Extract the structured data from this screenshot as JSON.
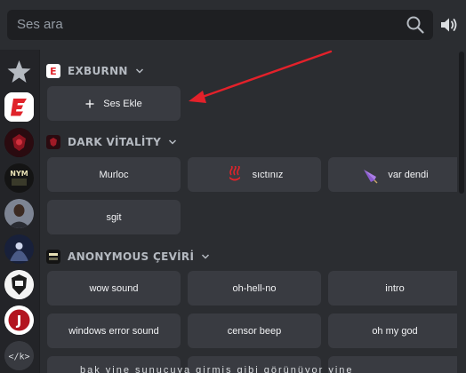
{
  "search": {
    "placeholder": "Ses ara",
    "icon": "search-icon"
  },
  "volume": {
    "icon": "volume-icon"
  },
  "rail": {
    "items": [
      {
        "name": "favorites",
        "icon": "star-icon"
      },
      {
        "name": "exburnn",
        "icon": "exburnn-logo-icon",
        "label": "E"
      },
      {
        "name": "dark-vitality",
        "icon": "dark-vitality-icon"
      },
      {
        "name": "anonymous-ceviri",
        "icon": "anonymous-avatar-icon",
        "label": "NYM"
      },
      {
        "name": "server-avatar-4",
        "icon": "person-avatar-icon"
      },
      {
        "name": "server-avatar-5",
        "icon": "dark-avatar-icon"
      },
      {
        "name": "server-avatar-6",
        "icon": "crest-avatar-icon"
      },
      {
        "name": "server-avatar-7",
        "icon": "j-avatar-icon",
        "label": "J"
      },
      {
        "name": "code",
        "icon": "code-icon",
        "label": "</k>"
      }
    ]
  },
  "sections": [
    {
      "title": "EXBURNN",
      "badge": "E",
      "buttons": [
        {
          "label": "Ses Ekle",
          "icon": "plus-icon"
        }
      ]
    },
    {
      "title": "DARK VİTALİTY",
      "badge": "",
      "buttons": [
        {
          "label": "Murloc"
        },
        {
          "label": "sıctınız",
          "emoji": "hot-springs-emoji"
        },
        {
          "label": "var dendi",
          "emoji": "umbrella-emoji"
        },
        {
          "label": "sgit"
        }
      ]
    },
    {
      "title": "ANONYMOUS ÇEVİRİ",
      "badge": "",
      "buttons": [
        {
          "label": "wow sound"
        },
        {
          "label": "oh-hell-no"
        },
        {
          "label": "intro"
        },
        {
          "label": "windows error sound"
        },
        {
          "label": "censor beep"
        },
        {
          "label": "oh my god"
        }
      ]
    }
  ],
  "colors": {
    "background": "#2b2d31",
    "search_bg": "#1e1f22",
    "button_bg": "#393b41",
    "rail_bg": "#232428",
    "accent_red": "#e0242b",
    "arrow": "#e3212a"
  },
  "bottom_caption": "bak yine sunucuya girmiş gibi görünüyor yine"
}
